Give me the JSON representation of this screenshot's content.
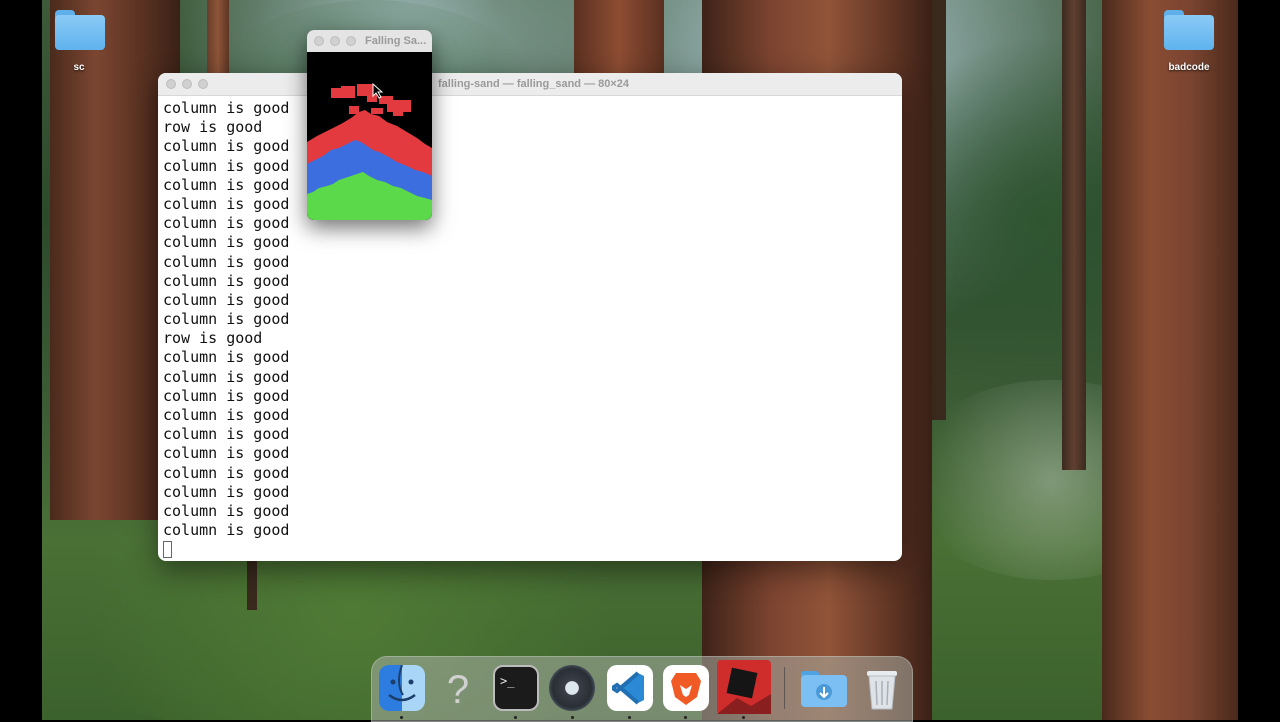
{
  "desktop": {
    "icons": [
      {
        "label": "sc"
      },
      {
        "label": "badcode"
      }
    ]
  },
  "terminal": {
    "title": "falling-sand — falling_sand — 80×24",
    "lines": [
      "column is good",
      "row is good",
      "column is good",
      "column is good",
      "column is good",
      "column is good",
      "column is good",
      "column is good",
      "column is good",
      "column is good",
      "column is good",
      "column is good",
      "row is good",
      "column is good",
      "column is good",
      "column is good",
      "column is good",
      "column is good",
      "column is good",
      "column is good",
      "column is good",
      "column is good",
      "column is good"
    ]
  },
  "sand_window": {
    "title": "Falling Sa...",
    "colors": {
      "red": "#e23a3f",
      "blue": "#3d6ee0",
      "green": "#5cd94a",
      "background": "#000000"
    }
  },
  "dock": {
    "items": [
      {
        "name": "finder-icon"
      },
      {
        "name": "help-icon"
      },
      {
        "name": "terminal-icon"
      },
      {
        "name": "quicktime-icon"
      },
      {
        "name": "vscode-icon"
      },
      {
        "name": "brave-icon"
      },
      {
        "name": "falling-sand-app-icon"
      },
      {
        "name": "downloads-folder-icon"
      },
      {
        "name": "trash-icon"
      }
    ]
  }
}
